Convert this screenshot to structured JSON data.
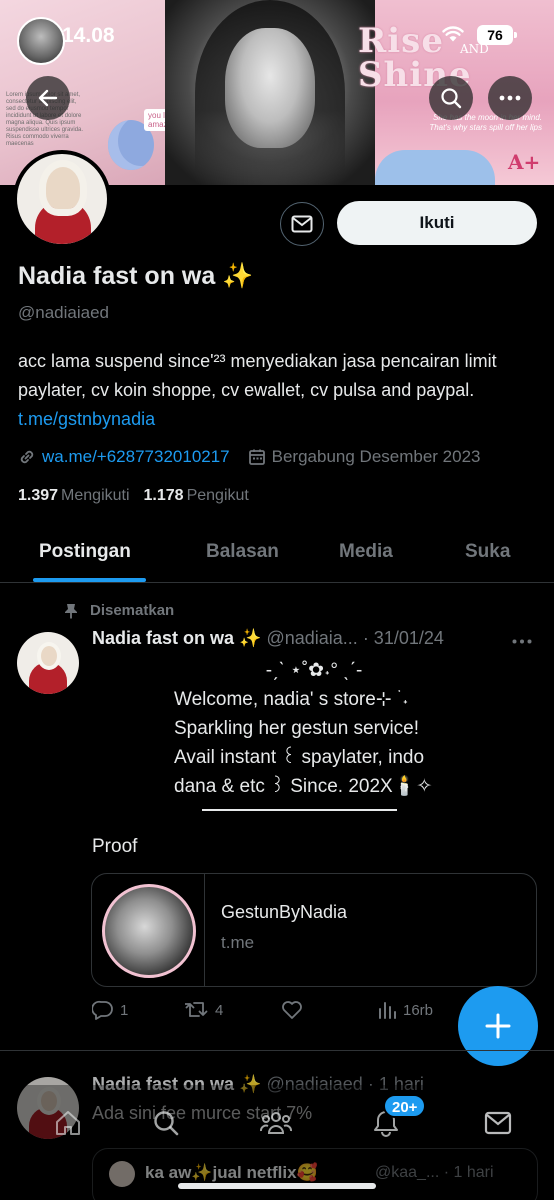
{
  "status": {
    "time": "14.08",
    "battery": "76"
  },
  "banner": {
    "title_word1": "Rise",
    "title_and": "AND",
    "title_word2": "Shine",
    "quote": "She has the moon in her mind. That's why stars spill off her lips",
    "tag": "you look amazing!",
    "grade": "A+",
    "lorem": "Lorem ipsum dolor sit amet, consectetur adipiscing elit, sed do eiusmod tempor incididunt ut labore et dolore magna aliqua. Quis ipsum suspendisse ultrices gravida. Risus commodo viverra maecenas"
  },
  "profile": {
    "display_name": "Nadia fast on wa ✨",
    "handle": "@nadiaiaed",
    "bio_text": "acc lama suspend since'²³ menyediakan jasa pencairan limit paylater, cv koin shoppe, cv ewallet, cv pulsa and paypal.",
    "bio_link": "t.me/gstnbynadia",
    "website": "wa.me/+6287732010217",
    "joined": "Bergabung Desember 2023",
    "following_count": "1.397",
    "following_label": "Mengikuti",
    "followers_count": "1.178",
    "followers_label": "Pengikut",
    "follow_button": "Ikuti"
  },
  "tabs": [
    {
      "label": "Postingan",
      "active": true
    },
    {
      "label": "Balasan",
      "active": false
    },
    {
      "label": "Media",
      "active": false
    },
    {
      "label": "Suka",
      "active": false
    }
  ],
  "pinned_tweet": {
    "pinned_label": "Disematkan",
    "name": "Nadia fast on wa ✨",
    "handle": "@nadiaia...",
    "date": "· 31/01/24",
    "deco_line": "-ˏˋ ⋆˚✿˖° ˎˊ-",
    "line1": "Welcome, nadia' s store⊹ ࣪ ˖",
    "line2": "Sparkling her gestun service!",
    "line3": "Avail instant ꒰ spaylater, indo",
    "line4": "dana & etc ꒱ Since. 202X🕯️✧",
    "proof": "Proof",
    "card_title": "GestunByNadia",
    "card_domain": "t.me",
    "replies": "1",
    "retweets": "4",
    "views": "16rb"
  },
  "second_tweet": {
    "name": "Nadia fast on wa ✨",
    "handle": "@nadiaiaed",
    "time": "· 1 hari",
    "text": "Ada sini fee murce start 7%",
    "quote_name": "ka aw✨jual netflix🥰",
    "quote_meta": "@kaa_... · 1 hari"
  },
  "nav": {
    "notif_badge": "20+"
  },
  "colors": {
    "accent": "#1d9bf0",
    "background": "#000000",
    "muted": "#71767b",
    "text": "#e7e9ea"
  }
}
